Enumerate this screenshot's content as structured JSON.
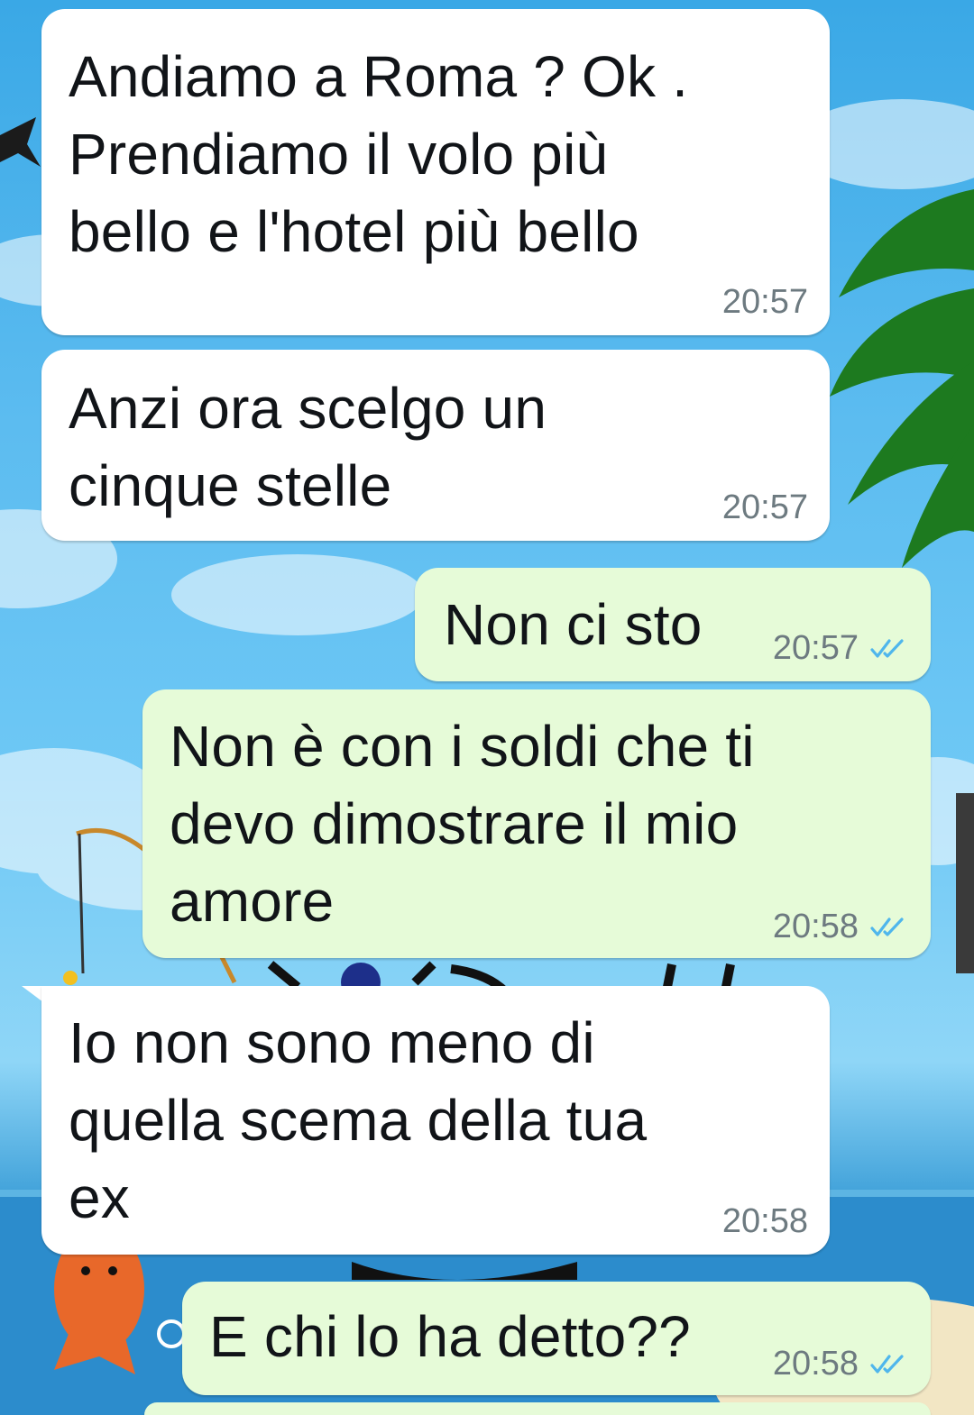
{
  "messages": [
    {
      "direction": "incoming",
      "lines": [
        "Andiamo a Roma ? Ok .",
        "Prendiamo il volo più",
        "bello e l'hotel più bello"
      ],
      "time": "20:57"
    },
    {
      "direction": "incoming",
      "lines": [
        "Anzi ora scelgo un",
        "cinque stelle"
      ],
      "time": "20:57"
    },
    {
      "direction": "outgoing",
      "lines": [
        "Non ci sto"
      ],
      "time": "20:57",
      "status": "read"
    },
    {
      "direction": "outgoing",
      "lines": [
        "Non è con i soldi che ti",
        "devo dimostrare il mio",
        "amore"
      ],
      "time": "20:58",
      "status": "read"
    },
    {
      "direction": "incoming",
      "lines": [
        "Io non sono meno di",
        "quella scema della tua",
        "ex"
      ],
      "time": "20:58"
    },
    {
      "direction": "outgoing",
      "lines": [
        "E chi lo ha detto??"
      ],
      "time": "20:58",
      "status": "read"
    }
  ],
  "colors": {
    "incoming_bubble": "#ffffff",
    "outgoing_bubble": "#e6fbd8",
    "read_ticks": "#4fb6ec",
    "timestamp": "#6d7a80"
  },
  "icons": {
    "read_status": "double-check-icon"
  }
}
